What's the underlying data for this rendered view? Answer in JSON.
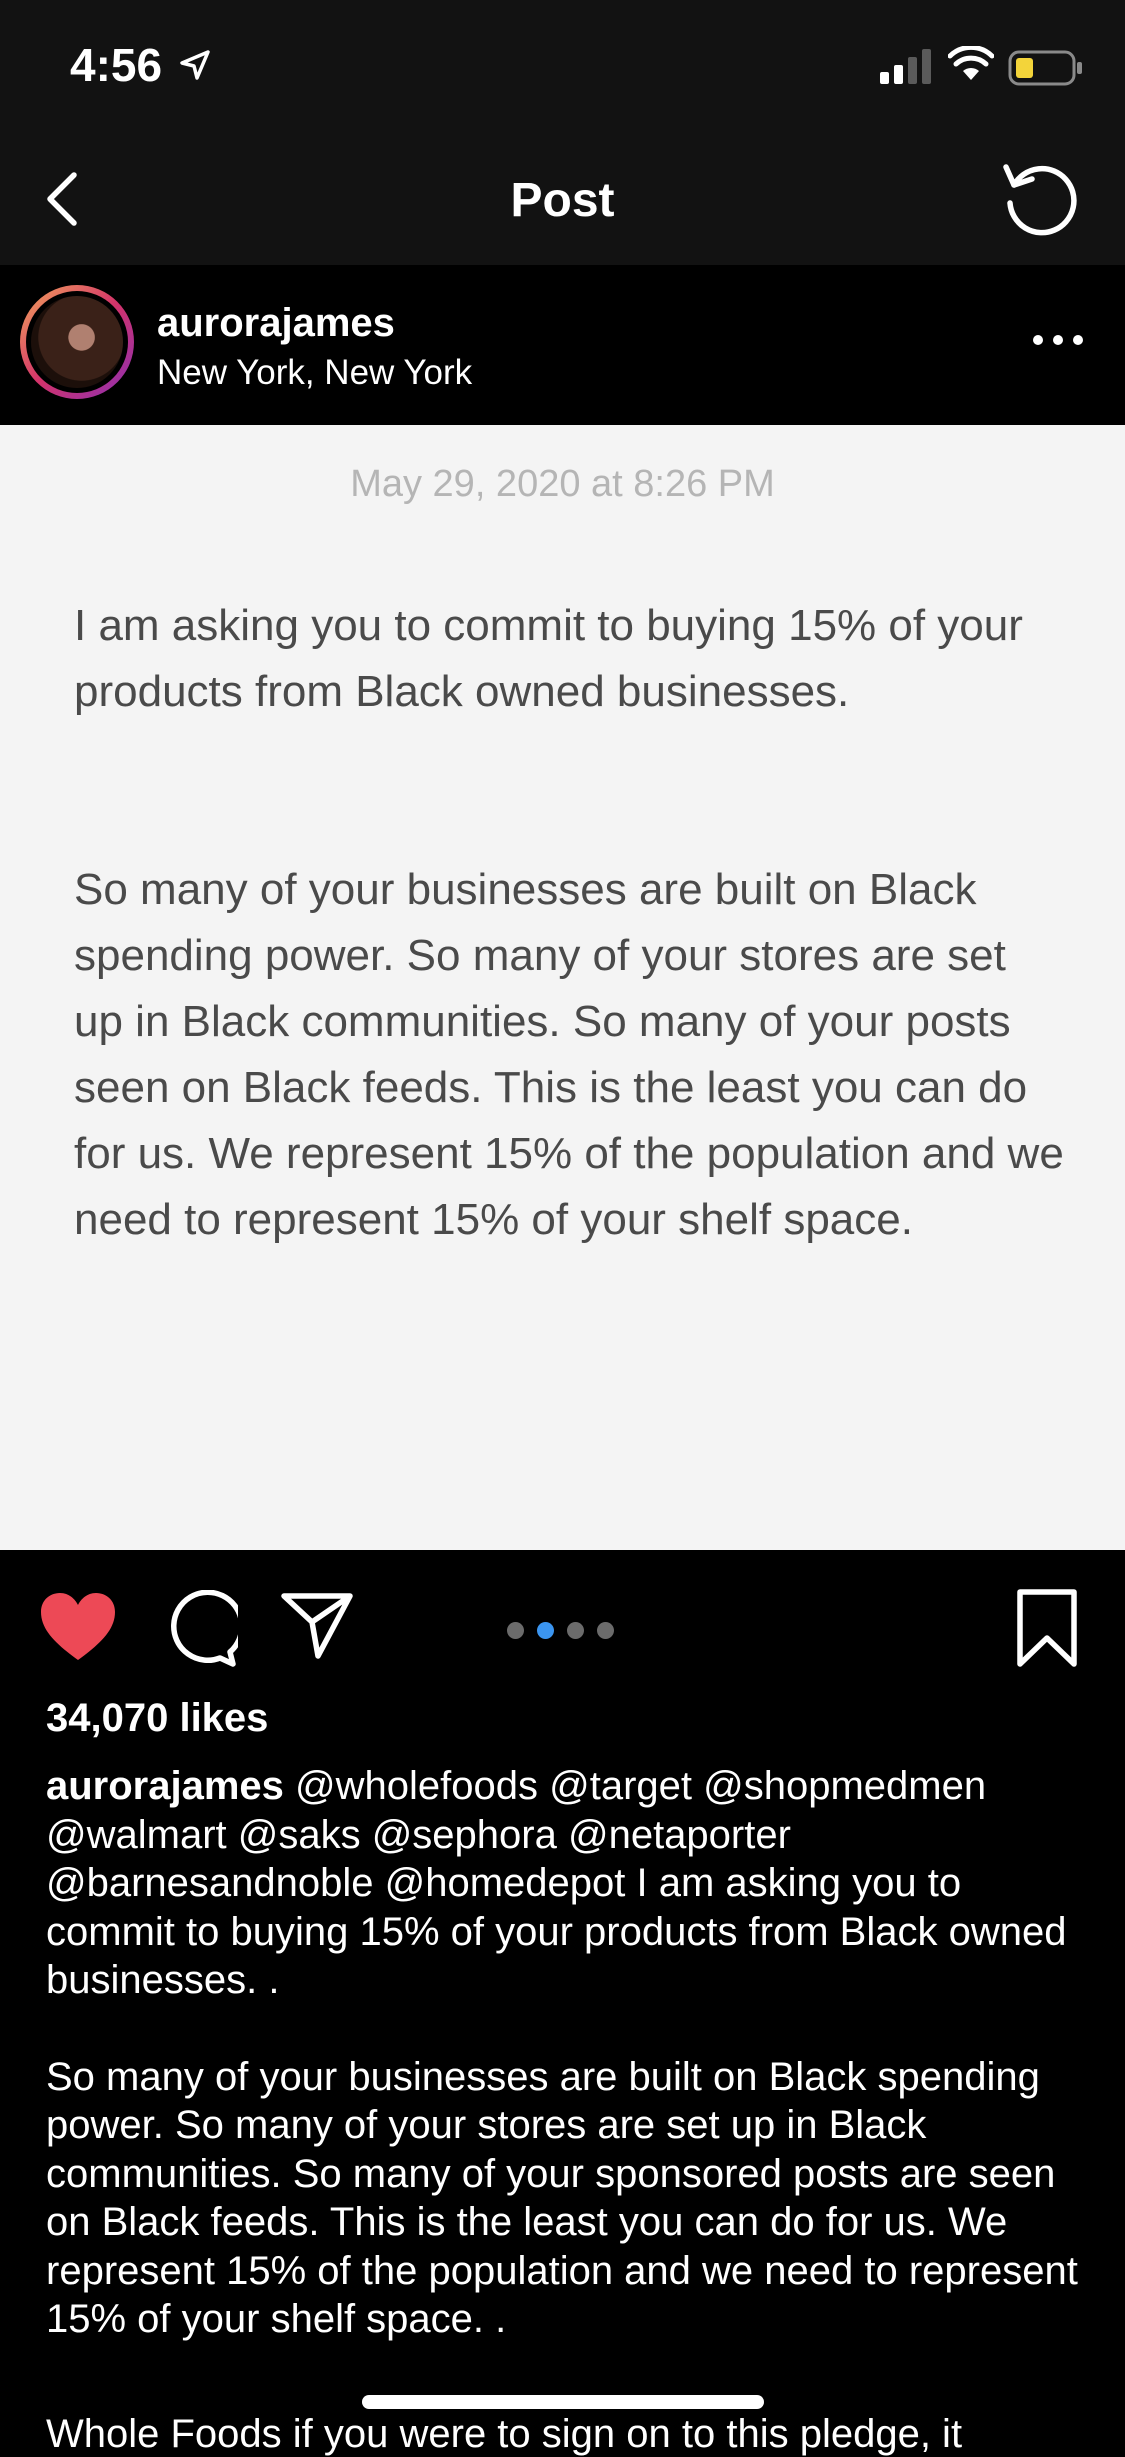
{
  "status_bar": {
    "time": "4:56",
    "icons": [
      "location-arrow-icon",
      "signal-icon",
      "wifi-icon",
      "battery-icon"
    ],
    "battery_color": "#f3d43a"
  },
  "nav": {
    "title": "Post",
    "back_icon": "chevron-left-icon",
    "refresh_icon": "refresh-icon"
  },
  "post": {
    "username": "aurorajames",
    "location": "New York, New York",
    "image": {
      "date": "May 29, 2020 at 8:26 PM",
      "paragraph1": "I am asking you to commit to buying 15% of your products from Black owned businesses.",
      "paragraph2": "So many of your businesses are built on Black spending power. So many of your stores are set up in Black communities. So many of your posts seen on Black feeds. This is the least you can do for us. We represent 15% of the population and we need to represent 15% of your shelf space."
    },
    "carousel": {
      "count": 4,
      "active_index": 1,
      "active_color": "#3b95f0"
    },
    "like_color": "#ed4956",
    "liked": true,
    "likes": "34,070 likes",
    "caption": {
      "username": "aurorajames",
      "text1": " @wholefoods @target @shopmedmen @walmart @saks @sephora @netaporter @barnesandnoble @homedepot I am asking you to commit to buying 15% of your products from Black owned businesses. .",
      "text2": "So many of your businesses are built on Black spending power. So many of your stores are set up in Black communities. So many of your sponsored posts are seen on Black feeds. This is the least you can do for us. We represent 15% of the population and we need to represent 15% of your shelf space. .",
      "text3_partial": "Whole Foods if you were to sign on to this pledge, it"
    }
  }
}
